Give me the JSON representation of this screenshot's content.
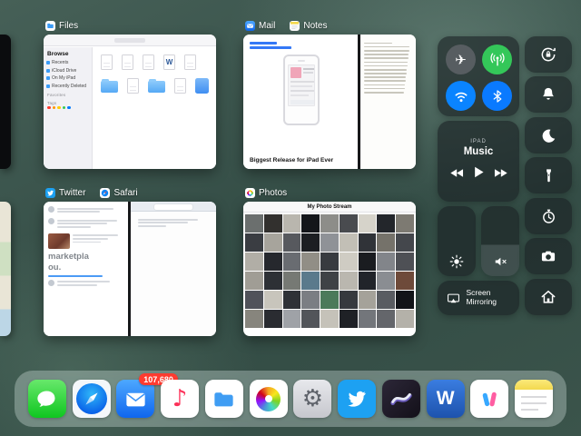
{
  "icons": {
    "airplane": "✈",
    "gear": "⚙",
    "music_note": "♪"
  },
  "control_center": {
    "colors": {
      "airplane_bg": "#575d61",
      "cellular": "#34c759",
      "wifi": "#0a84ff",
      "bluetooth": "#0a7aff",
      "badge": "#ff3b30"
    },
    "music": {
      "device": "IPAD",
      "app": "Music"
    },
    "screen_mirroring_label": "Screen Mirroring"
  },
  "switcher": {
    "cards": {
      "files": {
        "label": "Files",
        "sidebar_title": "Browse",
        "sidebar_items": [
          "Recents",
          "iCloud Drive",
          "On My iPad",
          "Recently Deleted"
        ],
        "section_favorites": "Favorites",
        "section_tags": "Tags",
        "grid": [
          "doc",
          "doc",
          "doc",
          "word",
          "doc",
          "folder",
          "doc",
          "folder",
          "doc",
          "bluedoc"
        ]
      },
      "mail_notes": {
        "label_left": "Mail",
        "label_right": "Notes",
        "headline": "Biggest Release for iPad Ever",
        "notes_line_count": 14
      },
      "twitter_safari": {
        "label_left": "Twitter",
        "label_right": "Safari",
        "big_text_1": "marketpla",
        "big_text_2": "ou."
      },
      "photos": {
        "label": "Photos",
        "title": "My Photo Stream",
        "thumbnails": [
          "#6b6f6e",
          "#32302e",
          "#b9b6ae",
          "#14161a",
          "#8d8d89",
          "#494b4f",
          "#d6d3ca",
          "#23262b",
          "#7d7a72",
          "#3a3d42",
          "#a7a49c",
          "#57595e",
          "#1c1e22",
          "#8f9297",
          "#c2bfb6",
          "#303338",
          "#75726a",
          "#44474c",
          "#b1aea6",
          "#26282d",
          "#696c71",
          "#918e86",
          "#383b40",
          "#cfccc3",
          "#1a1c20",
          "#82858a",
          "#4e5055",
          "#a09d95",
          "#2d3035",
          "#767974",
          "#5a7a8c",
          "#3f4246",
          "#bab7af",
          "#21242a",
          "#8a8d92",
          "#6e4a3a",
          "#50525a",
          "#c8c5bc",
          "#2f3237",
          "#7b7e83",
          "#4b7a5a",
          "#36393e",
          "#a5a29a",
          "#595c61",
          "#121418",
          "#87857d",
          "#2a2c31",
          "#9fa2a7",
          "#52555a",
          "#c5c2b9",
          "#1f2126",
          "#73767b",
          "#64666b",
          "#b4b1a9"
        ]
      }
    }
  },
  "dock": {
    "mail_badge": "107,680",
    "apps": [
      "Messages",
      "Safari",
      "Mail",
      "Music",
      "Files",
      "Photos",
      "Settings",
      "Twitter",
      "Procreate",
      "Word",
      "Apple Store",
      "Notes"
    ]
  }
}
